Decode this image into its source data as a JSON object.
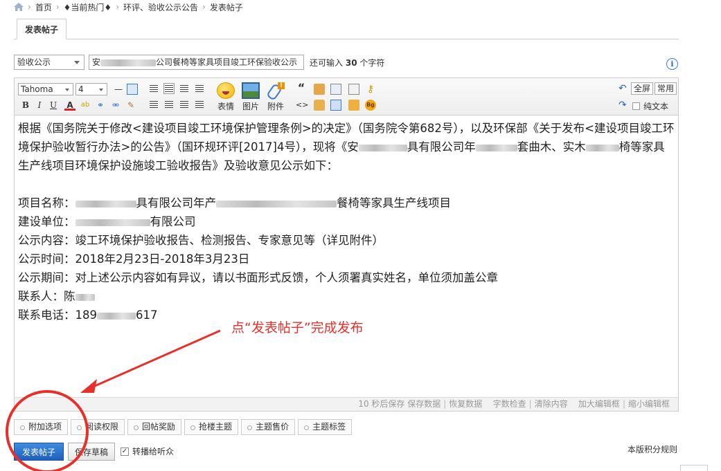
{
  "breadcrumb": {
    "items": [
      "首页",
      "♦当前热门♦",
      "环评、验收公示公告",
      "发表帖子"
    ]
  },
  "tab": {
    "label": "发表帖子"
  },
  "form": {
    "category_value": "验收公示",
    "title_prefix": "安",
    "title_suffix": "公司餐椅等家具项目竣工环保验收公示",
    "remaining_prefix": "还可输入",
    "remaining_count": "30",
    "remaining_suffix": "个字符"
  },
  "toolbar": {
    "font_family": "Tahoma",
    "font_size": "4",
    "emoji_label": "表情",
    "image_label": "图片",
    "attach_label": "附件",
    "fullscreen_label": "全屏",
    "common_label": "常用",
    "plaintext_label": "纯文本",
    "bold": "B",
    "italic": "I",
    "underline": "U",
    "color": "A",
    "quote": "“",
    "code": "<>",
    "bg": "Bg"
  },
  "content": {
    "para1_a": "根据《国务院关于修改<建设项目竣工环境保护管理条例>的决定》（国务院令第682号），以及环保部《关于发布<建设项目竣工环境保护验收暂行办法>的公告》（国环规环评[2017]4号），现将《安",
    "para1_b": "具有限公司年",
    "para1_c": "套曲木、实木",
    "para1_d": "椅等家具生产线项目环境保护设施竣工验收报告》及验收意见公示如下：",
    "name_label": "项目名称：",
    "name_a": "具有限公司年产",
    "name_b": "餐椅等家具生产线项目",
    "unit_label": "建设单位：",
    "unit_value": "有限公司",
    "content_label": "公示内容：",
    "content_value": "竣工环境保护验收报告、检测报告、专家意见等（详见附件）",
    "time_label": "公示时间：",
    "time_value": "2018年2月23日-2018年3月23日",
    "period_label": "公示期间：",
    "period_value": "对上述公示内容如有异议，请以书面形式反馈，个人须署真实姓名，单位须加盖公章",
    "contact_label": "联系人：",
    "contact_value": "陈",
    "phone_label": "联系电话：",
    "phone_a": "189",
    "phone_b": "617"
  },
  "statusbar": {
    "autosave": "10 秒后保存",
    "save": "保存数据",
    "restore": "恢复数据",
    "wordcount": "字数检查",
    "clear": "清除内容",
    "enlarge": "加大编辑框",
    "shrink": "缩小编辑框"
  },
  "options": [
    "附加选项",
    "阅读权限",
    "回帖奖励",
    "抢楼主题",
    "主题售价",
    "主题标签"
  ],
  "actions": {
    "submit": "发表帖子",
    "draft": "保存草稿",
    "share": "转播给听众",
    "rules": "本版积分规则"
  },
  "annotation": {
    "text": "点“发表帖子”完成发布",
    "color": "#e8302a"
  }
}
